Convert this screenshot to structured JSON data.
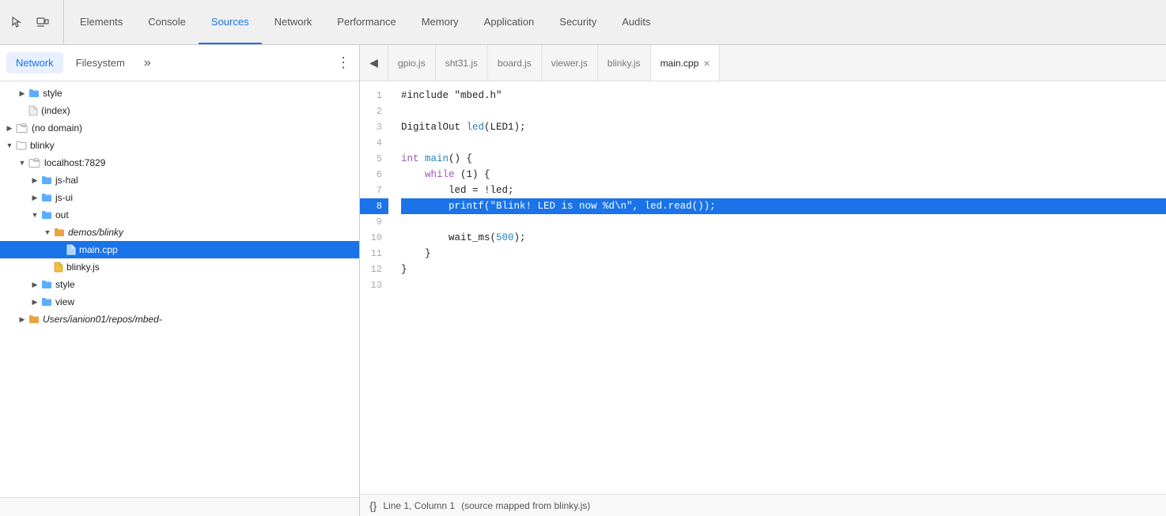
{
  "topNav": {
    "tabs": [
      {
        "id": "elements",
        "label": "Elements",
        "active": false
      },
      {
        "id": "console",
        "label": "Console",
        "active": false
      },
      {
        "id": "sources",
        "label": "Sources",
        "active": true
      },
      {
        "id": "network",
        "label": "Network",
        "active": false
      },
      {
        "id": "performance",
        "label": "Performance",
        "active": false
      },
      {
        "id": "memory",
        "label": "Memory",
        "active": false
      },
      {
        "id": "application",
        "label": "Application",
        "active": false
      },
      {
        "id": "security",
        "label": "Security",
        "active": false
      },
      {
        "id": "audits",
        "label": "Audits",
        "active": false
      }
    ]
  },
  "leftPanel": {
    "tabs": [
      {
        "id": "network",
        "label": "Network",
        "active": true
      },
      {
        "id": "filesystem",
        "label": "Filesystem",
        "active": false
      }
    ],
    "more": "»",
    "menuIcon": "⋮",
    "tree": [
      {
        "id": "style-folder",
        "indent": 1,
        "arrow": "▶",
        "type": "folder-blue",
        "label": "style"
      },
      {
        "id": "index-file",
        "indent": 1,
        "arrow": "",
        "type": "file-gray",
        "label": "(index)"
      },
      {
        "id": "nodomain-folder",
        "indent": 0,
        "arrow": "▶",
        "type": "folder-cloud",
        "label": "(no domain)"
      },
      {
        "id": "blinky-folder",
        "indent": 0,
        "arrow": "▼",
        "type": "folder-plain",
        "label": "blinky"
      },
      {
        "id": "localhost-folder",
        "indent": 1,
        "arrow": "▼",
        "type": "folder-cloud",
        "label": "localhost:7829"
      },
      {
        "id": "js-hal-folder",
        "indent": 2,
        "arrow": "▶",
        "type": "folder-blue",
        "label": "js-hal"
      },
      {
        "id": "js-ui-folder",
        "indent": 2,
        "arrow": "▶",
        "type": "folder-blue",
        "label": "js-ui"
      },
      {
        "id": "out-folder",
        "indent": 2,
        "arrow": "▼",
        "type": "folder-blue",
        "label": "out"
      },
      {
        "id": "demos-folder",
        "indent": 3,
        "arrow": "▼",
        "type": "folder-orange",
        "label": "demos/blinky"
      },
      {
        "id": "main-cpp-file",
        "indent": 4,
        "arrow": "",
        "type": "file-white",
        "label": "main.cpp",
        "selected": true
      },
      {
        "id": "blinky-js-file",
        "indent": 3,
        "arrow": "",
        "type": "file-yellow",
        "label": "blinky.js"
      },
      {
        "id": "style2-folder",
        "indent": 2,
        "arrow": "▶",
        "type": "folder-blue",
        "label": "style"
      },
      {
        "id": "view-folder",
        "indent": 2,
        "arrow": "▶",
        "type": "folder-blue",
        "label": "view"
      },
      {
        "id": "users-folder",
        "indent": 1,
        "arrow": "▶",
        "type": "folder-orange",
        "label": "Users/ianion01/repos/mbed-"
      }
    ]
  },
  "editorTabs": [
    {
      "id": "gpio-js",
      "label": "gpio.js",
      "active": false
    },
    {
      "id": "sht31-js",
      "label": "sht31.js",
      "active": false
    },
    {
      "id": "board-js",
      "label": "board.js",
      "active": false
    },
    {
      "id": "viewer-js",
      "label": "viewer.js",
      "active": false
    },
    {
      "id": "blinky-js",
      "label": "blinky.js",
      "active": false
    },
    {
      "id": "main-cpp",
      "label": "main.cpp",
      "active": true,
      "closable": true
    }
  ],
  "codeLines": [
    {
      "num": 1,
      "highlighted": false,
      "tokens": [
        {
          "text": "#include \"mbed.h\"",
          "color": "normal"
        }
      ]
    },
    {
      "num": 2,
      "highlighted": false,
      "tokens": []
    },
    {
      "num": 3,
      "highlighted": false,
      "tokens": [
        {
          "text": "DigitalOut ",
          "color": "normal"
        },
        {
          "text": "led",
          "color": "kw-blue"
        },
        {
          "text": "(LED1);",
          "color": "normal"
        }
      ]
    },
    {
      "num": 4,
      "highlighted": false,
      "tokens": []
    },
    {
      "num": 5,
      "highlighted": false,
      "tokens": [
        {
          "text": "int ",
          "color": "kw-purple"
        },
        {
          "text": "main",
          "color": "kw-blue"
        },
        {
          "text": "() {",
          "color": "normal"
        }
      ]
    },
    {
      "num": 6,
      "highlighted": false,
      "tokens": [
        {
          "text": "    ",
          "color": "normal"
        },
        {
          "text": "while",
          "color": "kw-purple"
        },
        {
          "text": " (1) {",
          "color": "normal"
        }
      ]
    },
    {
      "num": 7,
      "highlighted": false,
      "tokens": [
        {
          "text": "        led = !led;",
          "color": "normal"
        }
      ]
    },
    {
      "num": 8,
      "highlighted": true,
      "tokens": [
        {
          "text": "        printf(",
          "color": "normal"
        },
        {
          "text": "\"Blink! LED is now %d\\n\"",
          "color": "str-red"
        },
        {
          "text": ", led.read());",
          "color": "normal"
        }
      ]
    },
    {
      "num": 9,
      "highlighted": false,
      "tokens": []
    },
    {
      "num": 10,
      "highlighted": false,
      "tokens": [
        {
          "text": "        wait_ms(",
          "color": "normal"
        },
        {
          "text": "500",
          "color": "num-blue"
        },
        {
          "text": ");",
          "color": "normal"
        }
      ]
    },
    {
      "num": 11,
      "highlighted": false,
      "tokens": [
        {
          "text": "    }",
          "color": "normal"
        }
      ]
    },
    {
      "num": 12,
      "highlighted": false,
      "tokens": [
        {
          "text": "}",
          "color": "normal"
        }
      ]
    },
    {
      "num": 13,
      "highlighted": false,
      "tokens": []
    }
  ],
  "statusBar": {
    "curlyIcon": "{}",
    "position": "Line 1, Column 1",
    "sourceInfo": "(source mapped from blinky.js)"
  }
}
